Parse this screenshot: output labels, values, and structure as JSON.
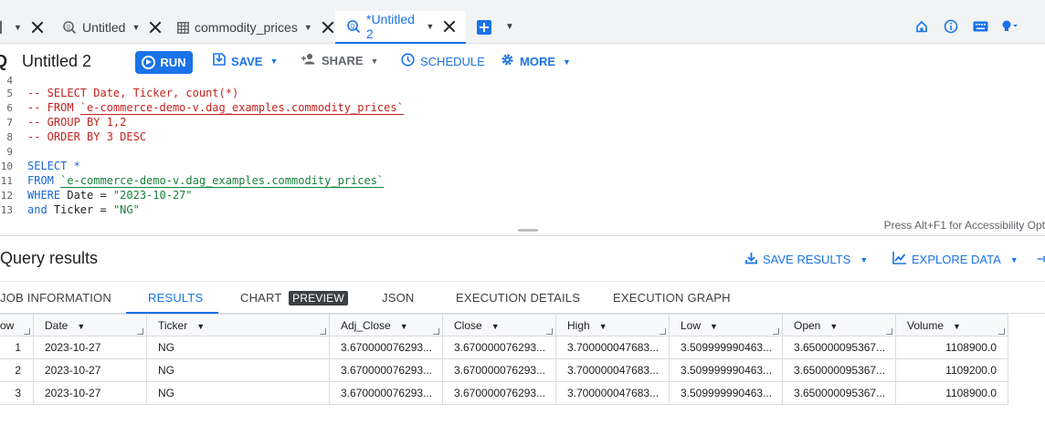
{
  "tabs": [
    {
      "label": "",
      "icon": "dataset-icon"
    },
    {
      "label": "Untitled",
      "icon": "query-icon"
    },
    {
      "label": "commodity_prices",
      "icon": "table-icon"
    },
    {
      "label": "*Untitled 2",
      "icon": "query-icon",
      "active": true
    }
  ],
  "toolbar": {
    "title": "Untitled 2",
    "run": "RUN",
    "save": "SAVE",
    "share": "SHARE",
    "schedule": "SCHEDULE",
    "more": "MORE"
  },
  "editor": {
    "lines": [
      {
        "n": "4",
        "text": ""
      },
      {
        "n": "5",
        "text": "-- SELECT Date, Ticker, count(*)"
      },
      {
        "n": "6",
        "pre": "-- FROM ",
        "ref": "`e-commerce-demo-v.dag_examples.commodity_prices`"
      },
      {
        "n": "7",
        "text": "-- GROUP BY 1,2"
      },
      {
        "n": "8",
        "text": "-- ORDER BY 3 DESC"
      },
      {
        "n": "9",
        "text": ""
      },
      {
        "n": "10",
        "text": "SELECT *"
      },
      {
        "n": "11",
        "kw": "FROM",
        "ref": "`e-commerce-demo-v.dag_examples.commodity_prices`"
      },
      {
        "n": "12",
        "kw": "WHERE",
        "mid": " Date = ",
        "str": "\"2023-10-27\""
      },
      {
        "n": "13",
        "kw": "and",
        "mid": " Ticker = ",
        "str": "\"NG\""
      }
    ],
    "a11y_hint": "Press Alt+F1 for Accessibility Opt"
  },
  "results": {
    "title": "Query results",
    "save_results": "SAVE RESULTS",
    "explore_data": "EXPLORE DATA",
    "tabs": [
      "JOB INFORMATION",
      "RESULTS",
      "CHART",
      "JSON",
      "EXECUTION DETAILS",
      "EXECUTION GRAPH"
    ],
    "chart_badge": "PREVIEW",
    "columns": [
      "ow",
      "Date",
      "Ticker",
      "Adj_Close",
      "Close",
      "High",
      "Low",
      "Open",
      "Volume"
    ],
    "rows": [
      [
        "1",
        "2023-10-27",
        "NG",
        "3.670000076293...",
        "3.670000076293...",
        "3.700000047683...",
        "3.509999990463...",
        "3.650000095367...",
        "1108900.0"
      ],
      [
        "2",
        "2023-10-27",
        "NG",
        "3.670000076293...",
        "3.670000076293...",
        "3.700000047683...",
        "3.509999990463...",
        "3.650000095367...",
        "1109200.0"
      ],
      [
        "3",
        "2023-10-27",
        "NG",
        "3.670000076293...",
        "3.670000076293...",
        "3.700000047683...",
        "3.509999990463...",
        "3.650000095367...",
        "1108900.0"
      ]
    ]
  },
  "colors": {
    "accent": "#1a73e8",
    "comment": "#c5221f",
    "string": "#188038",
    "keyword": "#1967d2"
  }
}
